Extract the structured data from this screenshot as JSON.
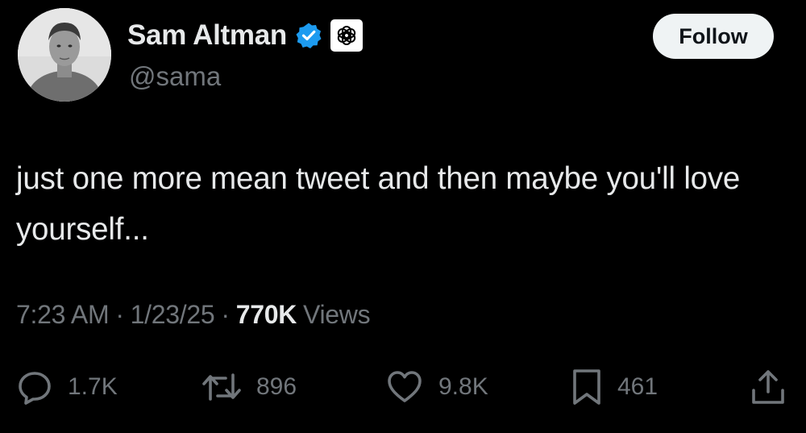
{
  "author": {
    "display_name": "Sam Altman",
    "handle": "@sama",
    "avatar_icon": "profile-photo",
    "verified_badge_icon": "verified-badge-icon",
    "affiliate_badge_icon": "openai-logo-icon",
    "verified_color": "#1d9bf0"
  },
  "follow_button": {
    "label": "Follow"
  },
  "tweet": {
    "text": "just one more mean tweet and then maybe you'll love yourself..."
  },
  "meta": {
    "time": "7:23 AM",
    "separator": "·",
    "date": "1/23/25",
    "views_count": "770K",
    "views_label": "Views"
  },
  "actions": {
    "reply": {
      "icon": "reply-icon",
      "count": "1.7K"
    },
    "repost": {
      "icon": "repost-icon",
      "count": "896"
    },
    "like": {
      "icon": "like-icon",
      "count": "9.8K"
    },
    "bookmark": {
      "icon": "bookmark-icon",
      "count": "461"
    },
    "share": {
      "icon": "share-icon"
    }
  },
  "colors": {
    "background": "#000000",
    "primary_text": "#e7e9ea",
    "secondary_text": "#71767b",
    "follow_button_bg": "#eff3f4"
  }
}
